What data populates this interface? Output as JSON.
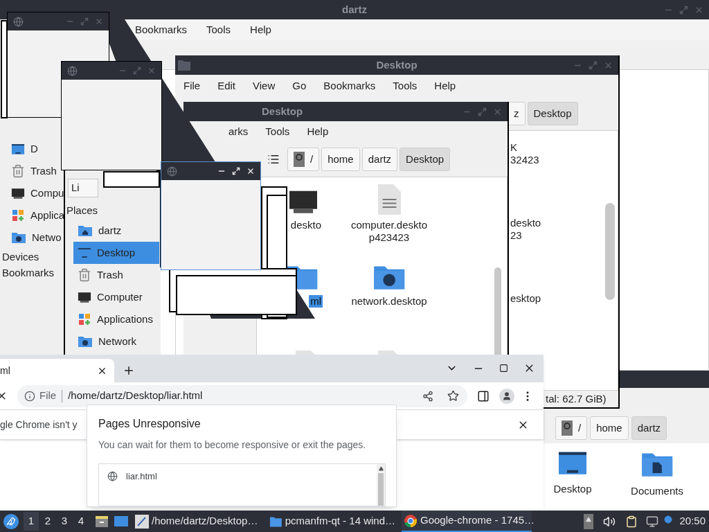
{
  "back_window": {
    "title": "dartz",
    "menu": [
      "Bookmarks",
      "Tools",
      "Help"
    ],
    "places": [
      {
        "label": "D",
        "kind": "desktop"
      },
      {
        "label": "Trash",
        "kind": "trash"
      },
      {
        "label": "Compu",
        "kind": "computer"
      },
      {
        "label": "Applica",
        "kind": "apps"
      },
      {
        "label": "Netwo",
        "kind": "network"
      }
    ],
    "sections": [
      "Devices",
      "Bookmarks"
    ]
  },
  "middle_window": {
    "title": "Desktop",
    "menu": [
      "File",
      "Edit",
      "View",
      "Go",
      "Bookmarks",
      "Tools",
      "Help"
    ],
    "path": [
      {
        "label": "z",
        "selected": false
      },
      {
        "label": "Desktop",
        "selected": true
      }
    ],
    "files": [
      {
        "lines": [
          "K",
          "32423"
        ]
      },
      {
        "lines": [
          "deskto",
          "23"
        ]
      },
      {
        "lines": [
          "esktop"
        ]
      }
    ],
    "status": "tal: 62.7 GiB)"
  },
  "front_window": {
    "title": "Desktop",
    "menu": [
      "arks",
      "Tools",
      "Help"
    ],
    "path": [
      {
        "label": "/",
        "kind": "root",
        "selected": false
      },
      {
        "label": "home",
        "kind": "folder",
        "selected": false
      },
      {
        "label": "dartz",
        "kind": "folder",
        "selected": false
      },
      {
        "label": "Desktop",
        "kind": "folder",
        "selected": true
      }
    ],
    "files": [
      {
        "kind": "computer",
        "lines": [
          "deskto"
        ],
        "selected": false
      },
      {
        "kind": "document",
        "lines": [
          "computer.deskto",
          "p423423"
        ],
        "selected": false
      },
      {
        "kind": "folder",
        "lines": [
          "ml"
        ],
        "selected": true
      },
      {
        "kind": "network",
        "lines": [
          "network.desktop"
        ],
        "selected": false
      },
      {
        "kind": "document"
      },
      {
        "kind": "document"
      }
    ]
  },
  "places_window": {
    "combo": "Li",
    "section": "Places",
    "places": [
      {
        "label": "dartz",
        "kind": "home",
        "selected": false
      },
      {
        "label": "Desktop",
        "kind": "desktop",
        "selected": true
      },
      {
        "label": "Trash",
        "kind": "trash",
        "selected": false
      },
      {
        "label": "Computer",
        "kind": "computer",
        "selected": false
      },
      {
        "label": "Applications",
        "kind": "apps",
        "selected": false
      },
      {
        "label": "Network",
        "kind": "network",
        "selected": false
      }
    ]
  },
  "corner_window": {
    "path": [
      {
        "label": "/",
        "kind": "root",
        "selected": false
      },
      {
        "label": "home",
        "kind": "folder",
        "selected": false
      },
      {
        "label": "dartz",
        "kind": "folder",
        "selected": true
      }
    ],
    "folders": [
      {
        "label": "Desktop",
        "kind": "desktop"
      },
      {
        "label": "Documents",
        "kind": "documents"
      }
    ]
  },
  "chrome": {
    "tab": "ml",
    "scheme": "File",
    "url": "/home/dartz/Desktop/liar.html",
    "infobar": "gle Chrome isn't y",
    "dialog": {
      "title": "Pages Unresponsive",
      "message": "You can wait for them to become responsive or exit the pages.",
      "pages": [
        "liar.html"
      ]
    }
  },
  "taskbar": {
    "workspaces": [
      {
        "label": "1",
        "selected": true
      },
      {
        "label": "2",
        "selected": false
      },
      {
        "label": "3",
        "selected": false
      },
      {
        "label": "4",
        "selected": false
      }
    ],
    "tasks": [
      {
        "label": "/home/dartz/Desktop…",
        "kind": "editor",
        "selected": false
      },
      {
        "label": "pcmanfm-qt - 14 wind…",
        "kind": "folder",
        "selected": false
      },
      {
        "label": "Google-chrome - 1745…",
        "kind": "chrome",
        "selected": true
      }
    ],
    "clock": "20:50"
  }
}
